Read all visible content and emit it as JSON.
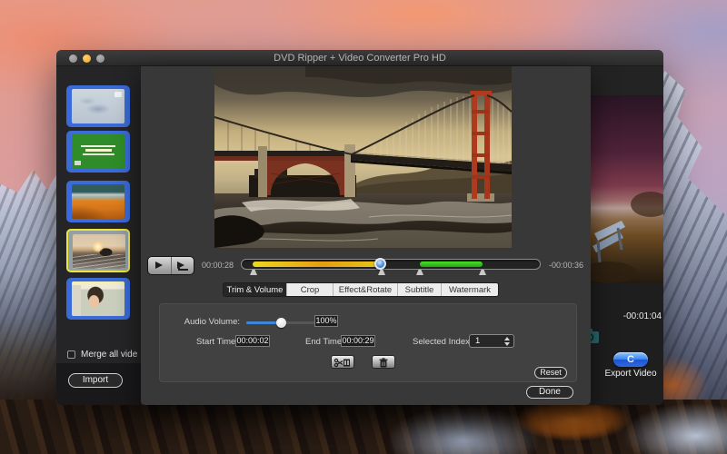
{
  "window": {
    "title": "DVD Ripper + Video Converter Pro HD"
  },
  "sidebar": {
    "merge_label": "Merge all vide",
    "import_label": "Import",
    "thumbnails": [
      {
        "name": "sketch-clip"
      },
      {
        "name": "green-slide-clip"
      },
      {
        "name": "desert-dune-clip"
      },
      {
        "name": "sunset-beach-clip",
        "selected": true
      },
      {
        "name": "portrait-clip"
      }
    ]
  },
  "dialog": {
    "transport": {
      "current_time": "00:00:28",
      "remaining_time": "-00:00:36"
    },
    "tabs": [
      {
        "label": "Trim & Volume",
        "selected": true
      },
      {
        "label": "Crop",
        "selected": false
      },
      {
        "label": "Effect&Rotate",
        "selected": false
      },
      {
        "label": "Subtitle",
        "selected": false
      },
      {
        "label": "Watermark",
        "selected": false
      }
    ],
    "trim_panel": {
      "audio_volume_label": "Audio Volume:",
      "audio_volume_value": "100%",
      "start_time_label": "Start Time:",
      "start_time_value": "00:00:02",
      "end_time_label": "End Time:",
      "end_time_value": "00:00:29",
      "selected_index_label": "Selected Index:",
      "selected_index_value": "1",
      "reset_label": "Reset"
    },
    "done_label": "Done"
  },
  "preview_panel": {
    "remaining_total": "-00:01:04",
    "export_icon_letter": "C",
    "export_label": "Export Video"
  },
  "colors": {
    "sidebar_selection_blue": "#3a6bd8",
    "current_item_yellow": "#ece642",
    "trim_progress_yellow": "#e8c51a",
    "trim_selection_green": "#35cc1e",
    "export_button_blue": "#2f6ae0",
    "volume_slider_blue": "#3f86d8"
  }
}
